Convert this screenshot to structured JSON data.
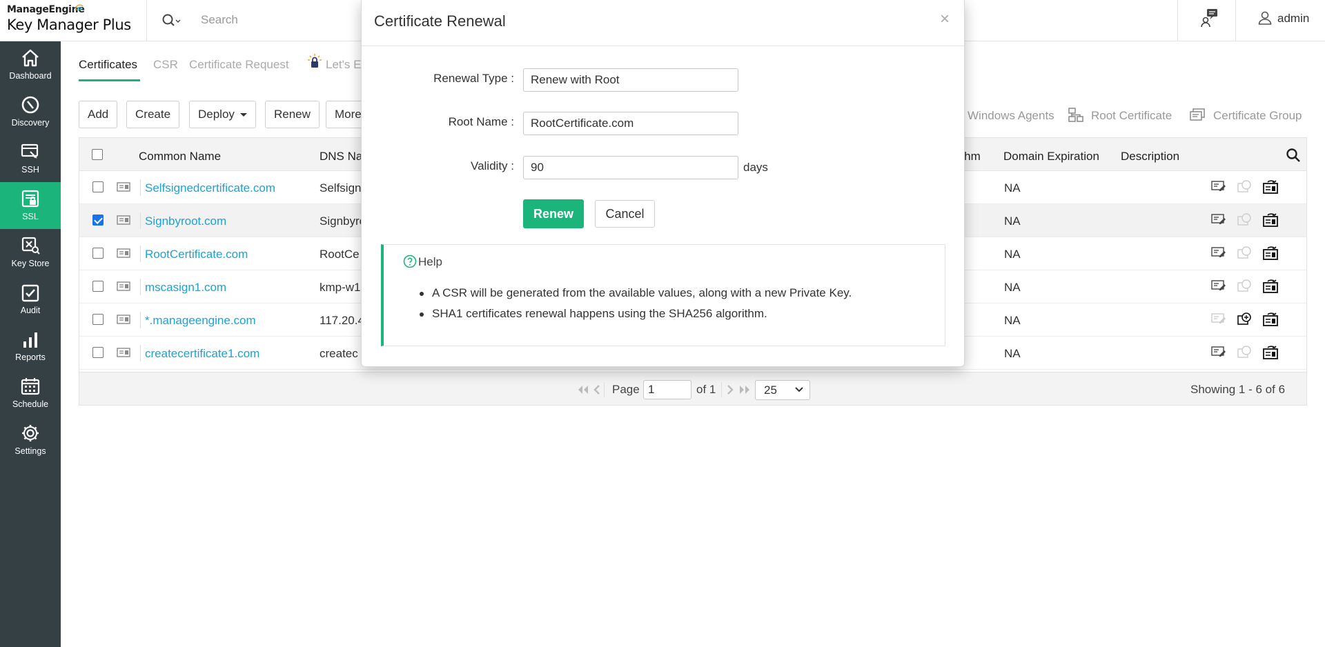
{
  "header": {
    "brand": "ManageEngine",
    "product": "Key Manager Plus",
    "search_placeholder": "Search",
    "user": "admin"
  },
  "sidebar": {
    "items": [
      {
        "label": "Dashboard",
        "icon": "home-icon",
        "active": false
      },
      {
        "label": "Discovery",
        "icon": "discovery-icon",
        "active": false
      },
      {
        "label": "SSH",
        "icon": "ssh-icon",
        "active": false
      },
      {
        "label": "SSL",
        "icon": "ssl-icon",
        "active": true
      },
      {
        "label": "Key Store",
        "icon": "key-store-icon",
        "active": false
      },
      {
        "label": "Audit",
        "icon": "audit-icon",
        "active": false
      },
      {
        "label": "Reports",
        "icon": "reports-icon",
        "active": false
      },
      {
        "label": "Schedule",
        "icon": "schedule-icon",
        "active": false
      },
      {
        "label": "Settings",
        "icon": "settings-icon",
        "active": false
      }
    ]
  },
  "tabs": [
    "Certificates",
    "CSR",
    "Certificate Request",
    "Let's E"
  ],
  "toolbar": {
    "add": "Add",
    "create": "Create",
    "deploy": "Deploy",
    "renew": "Renew",
    "more": "More"
  },
  "right_links": {
    "windows_agents": "Windows Agents",
    "root_certificate": "Root Certificate",
    "certificate_group": "Certificate Group"
  },
  "table": {
    "columns": {
      "common_name": "Common Name",
      "dns_name": "DNS Na",
      "algorithm": "rithm",
      "domain_expiration": "Domain Expiration",
      "description": "Description"
    },
    "rows": [
      {
        "common_name": "Selfsignedcertificate.com",
        "dns": "Selfsign",
        "expiration": "NA",
        "checked": false
      },
      {
        "common_name": "Signbyroot.com",
        "dns": "Signbyro",
        "expiration": "NA",
        "checked": true
      },
      {
        "common_name": "RootCertificate.com",
        "dns": "RootCe",
        "expiration": "NA",
        "checked": false
      },
      {
        "common_name": "mscasign1.com",
        "dns": "kmp-w1",
        "expiration": "NA",
        "checked": false
      },
      {
        "common_name": "*.manageengine.com",
        "dns": "117.20.4",
        "expiration": "NA",
        "checked": false
      },
      {
        "common_name": "createcertificate1.com",
        "dns": "createc",
        "expiration": "NA",
        "checked": false
      }
    ]
  },
  "pager": {
    "page_label": "Page",
    "page": "1",
    "of_label": "of 1",
    "per_page": "25",
    "showing": "Showing 1 - 6 of 6"
  },
  "modal": {
    "title": "Certificate Renewal",
    "close": "×",
    "renewal_type_label": "Renewal Type :",
    "renewal_type_value": "Renew with Root",
    "root_name_label": "Root Name :",
    "root_name_value": "RootCertificate.com",
    "validity_label": "Validity :",
    "validity_value": "90",
    "days_label": "days",
    "renew_button": "Renew",
    "cancel_button": "Cancel",
    "help_title": "Help",
    "help_items": [
      "A CSR will be generated from the available values, along with a new Private Key.",
      "SHA1 certificates renewal happens using the SHA256 algorithm."
    ]
  },
  "colors": {
    "accent": "#1bb57c",
    "sidebar": "#354045",
    "link": "#1aa3d8"
  }
}
